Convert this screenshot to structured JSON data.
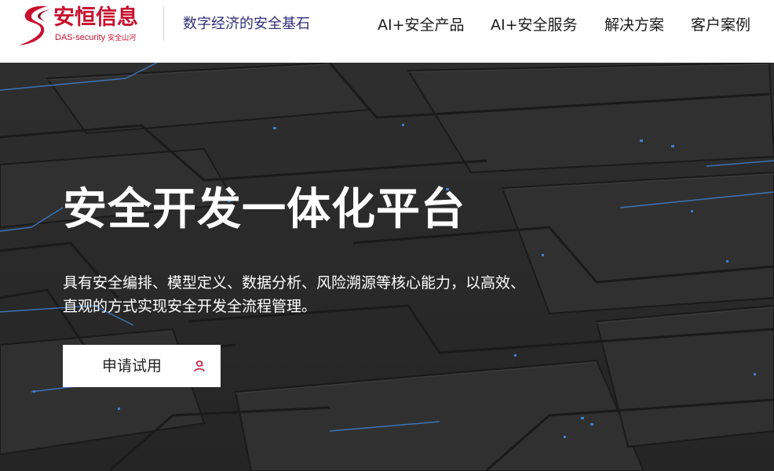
{
  "header": {
    "logo_cn": "安恒信息",
    "logo_en": "DAS-security",
    "logo_en_sub": "安全山河",
    "slogan": "数字经济的安全基石",
    "nav": [
      {
        "label": "AI+安全产品"
      },
      {
        "label": "AI+安全服务"
      },
      {
        "label": "解决方案"
      },
      {
        "label": "客户案例"
      }
    ]
  },
  "hero": {
    "title": "安全开发一体化平台",
    "description": "具有安全编排、模型定义、数据分析、风险溯源等核心能力，以高效、直观的方式实现安全开发全流程管理。",
    "cta_label": "申请试用",
    "cta_icon": "user-headset-icon"
  },
  "colors": {
    "brand_red": "#c8102e",
    "slogan_navy": "#30307a",
    "hero_background": "#2a2a2a",
    "circuit_blue": "#3d7fd0"
  }
}
